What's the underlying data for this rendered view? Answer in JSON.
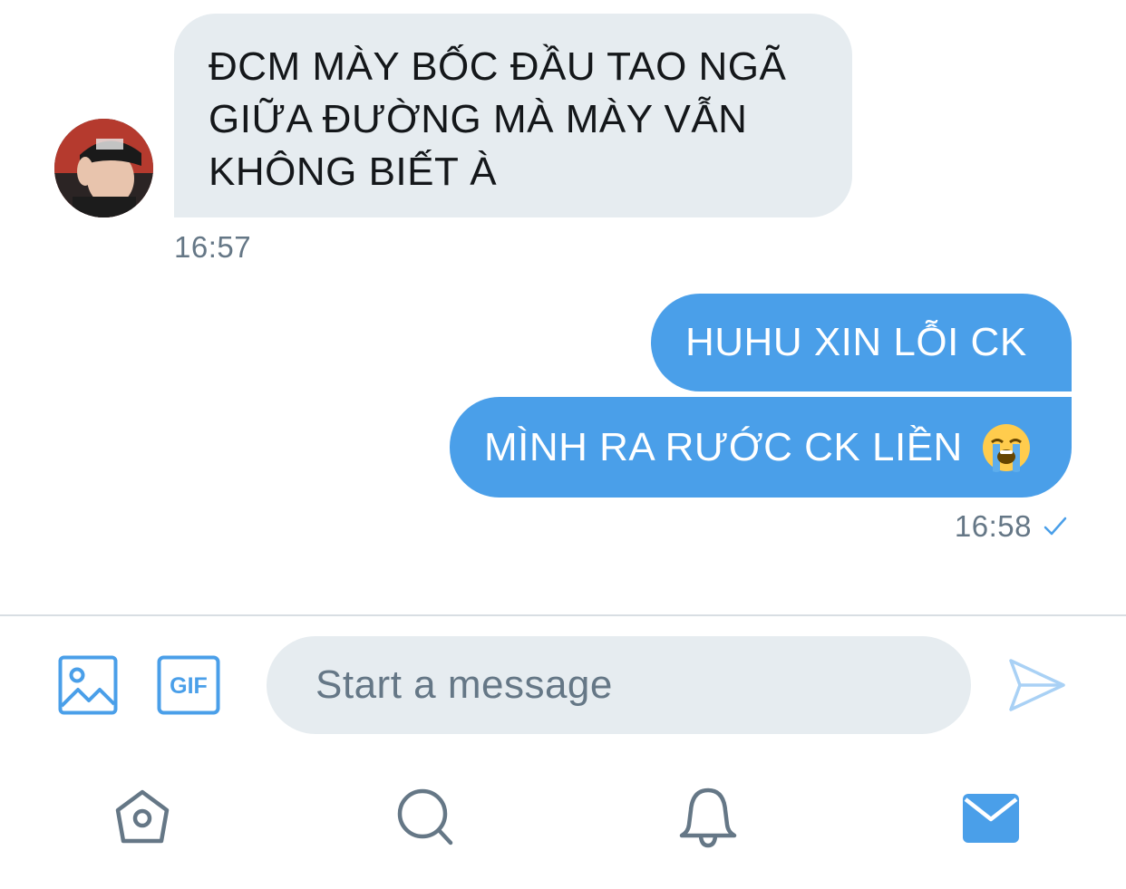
{
  "conversation": {
    "incoming": {
      "lines": [
        "ĐCM MÀY BỐC ĐẦU TAO NGÃ",
        "GIỮA ĐƯỜNG MÀ MÀY VẪN",
        "KHÔNG BIẾT À"
      ],
      "timestamp": "16:57"
    },
    "outgoing": {
      "messages": [
        {
          "text": "HUHU XIN LỖI CK"
        },
        {
          "text": "MÌNH RA RƯỚC CK LIỀN",
          "emoji": "loudly-crying-face"
        }
      ],
      "timestamp": "16:58",
      "status_icon": "checkmark-icon"
    }
  },
  "composer": {
    "placeholder": "Start a message",
    "value": "",
    "gif_label": "GIF",
    "icons": [
      "image-icon",
      "gif-icon",
      "send-icon"
    ]
  },
  "tab_bar": {
    "items": [
      "home-icon",
      "search-icon",
      "notifications-icon",
      "messages-icon"
    ],
    "active": "messages-icon"
  },
  "colors": {
    "accent": "#1da1f2",
    "outgoing_bubble": "#4a9fe9",
    "incoming_bubble": "#e6ecf0",
    "secondary_text": "#657786",
    "icon_gray": "#657786"
  }
}
